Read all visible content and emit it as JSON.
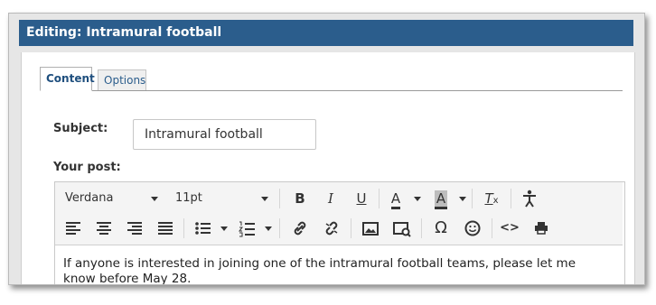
{
  "window": {
    "title": "Editing: Intramural football"
  },
  "tabs": [
    {
      "label": "Content",
      "active": true
    },
    {
      "label": "Options",
      "active": false
    }
  ],
  "subject": {
    "label": "Subject:",
    "value": "Intramural football"
  },
  "post": {
    "label": "Your post:"
  },
  "toolbar": {
    "font_family": "Verdana",
    "font_size": "11pt",
    "icons": [
      "bold-icon",
      "italic-icon",
      "underline-icon",
      "text-color-icon",
      "background-color-icon",
      "clear-formatting-icon",
      "accessibility-icon",
      "align-left-icon",
      "align-center-icon",
      "align-right-icon",
      "justify-icon",
      "bullet-list-icon",
      "numbered-list-icon",
      "link-icon",
      "unlink-icon",
      "image-icon",
      "media-icon",
      "special-character-icon",
      "emoji-icon",
      "source-code-icon",
      "print-icon"
    ]
  },
  "editor": {
    "content": "If anyone is interested in joining one of the intramural football teams, please let me know before May 28."
  },
  "colors": {
    "titlebar": "#2b5d8c",
    "accent": "#1f4f7e"
  }
}
